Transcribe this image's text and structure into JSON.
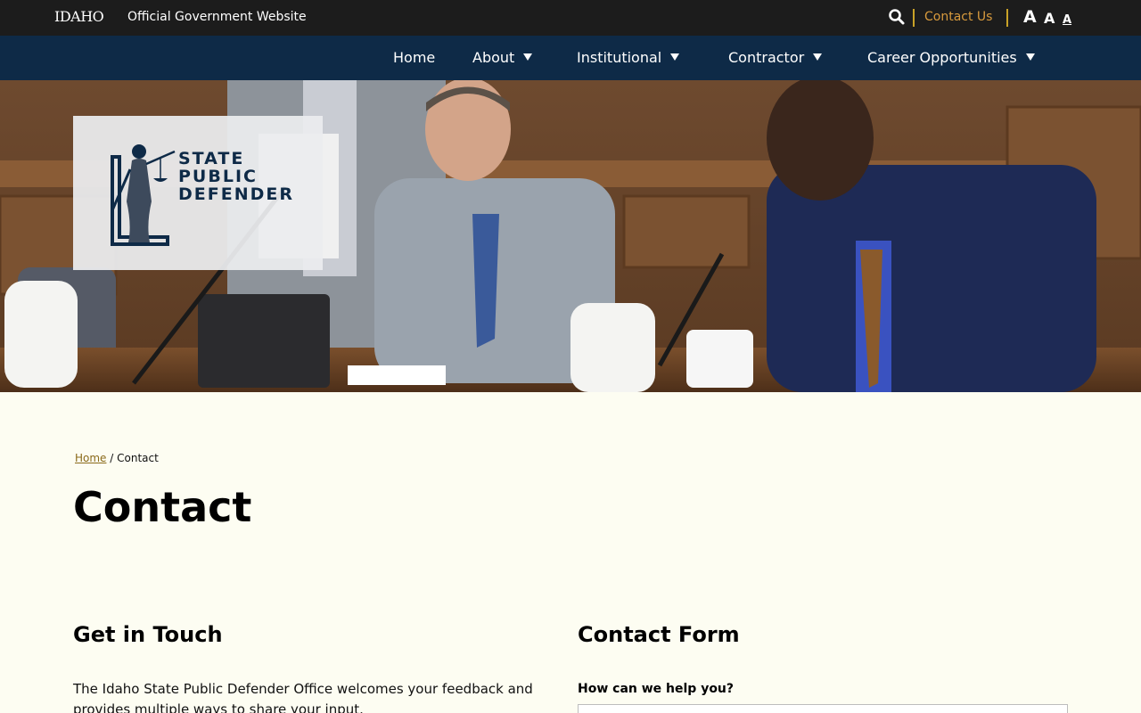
{
  "utility_bar": {
    "brand": "IDAHO",
    "official_label": "Official Government Website",
    "contact_label": "Contact Us",
    "font_sizes": [
      "A",
      "A",
      "A"
    ]
  },
  "nav": {
    "items": [
      {
        "label": "Home",
        "has_dropdown": false
      },
      {
        "label": "About",
        "has_dropdown": true
      },
      {
        "label": "Institutional",
        "has_dropdown": true
      },
      {
        "label": "Contractor",
        "has_dropdown": true
      },
      {
        "label": "Career Opportunities",
        "has_dropdown": true
      }
    ]
  },
  "logo": {
    "line1": "STATE",
    "line2": "PUBLIC",
    "line3": "DEFENDER"
  },
  "breadcrumb": {
    "home": "Home",
    "separator": "/",
    "current": "Contact"
  },
  "page": {
    "title": "Contact"
  },
  "get_in_touch": {
    "heading": "Get in Touch",
    "text": "The Idaho State Public Defender Office welcomes your feedback and provides multiple ways to share your input."
  },
  "contact_form": {
    "heading": "Contact Form",
    "help_label": "How can we help you?"
  },
  "colors": {
    "utility_bg": "#1c1c1c",
    "nav_bg": "#0e2a47",
    "accent": "#d89a3d",
    "page_bg": "#fdfdf2"
  }
}
